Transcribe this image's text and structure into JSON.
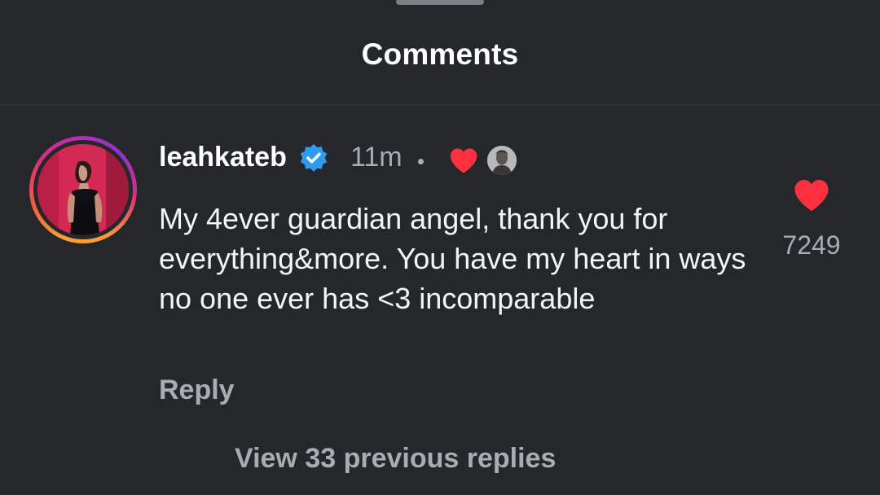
{
  "header": {
    "title": "Comments"
  },
  "comment": {
    "username": "leahkateb",
    "verified": true,
    "timestamp": "11m",
    "liked_by_author": true,
    "text": "My 4ever guardian angel, thank you for everything&more. You have my heart in ways no one ever has <3 incomparable",
    "likes": "7249",
    "reply_label": "Reply"
  },
  "replies": {
    "view_label": "View 33 previous replies"
  },
  "colors": {
    "background": "#25272b",
    "heart": "#ff3040",
    "verified": "#2d9bf0",
    "secondary_text": "#a9acb2"
  },
  "icons": {
    "verified": "verified-badge-icon",
    "heart": "heart-icon"
  }
}
